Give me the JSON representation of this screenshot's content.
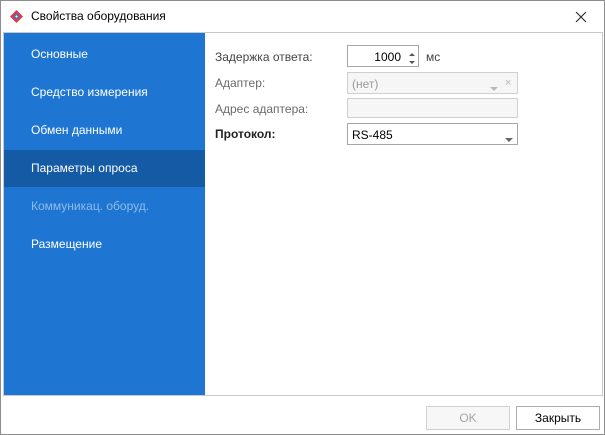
{
  "window": {
    "title": "Свойства оборудования"
  },
  "sidebar": {
    "items": [
      {
        "label": "Основные",
        "state": "normal"
      },
      {
        "label": "Средство измерения",
        "state": "normal"
      },
      {
        "label": "Обмен данными",
        "state": "normal"
      },
      {
        "label": "Параметры опроса",
        "state": "active"
      },
      {
        "label": "Коммуникац. оборуд.",
        "state": "disabled"
      },
      {
        "label": "Размещение",
        "state": "normal"
      }
    ]
  },
  "form": {
    "response_delay": {
      "label": "Задержка ответа:",
      "value": "1000",
      "unit": "мс"
    },
    "adapter": {
      "label": "Адаптер:",
      "value": "(нет)",
      "clear": "×"
    },
    "adapter_address": {
      "label": "Адрес адаптера:",
      "value": ""
    },
    "protocol": {
      "label": "Протокол:",
      "value": "RS-485"
    }
  },
  "footer": {
    "ok_label": "OK",
    "close_label": "Закрыть"
  },
  "colors": {
    "sidebar_bg": "#1e76d2",
    "sidebar_active": "#145aa4",
    "app_icon_red": "#e0393e",
    "app_icon_blue": "#2f7fd6"
  },
  "icons": {
    "app": "app-logo-icon",
    "close": "close-icon",
    "spin_up": "spin-up-icon",
    "spin_down": "spin-down-icon",
    "dropdown": "chevron-down-icon"
  }
}
